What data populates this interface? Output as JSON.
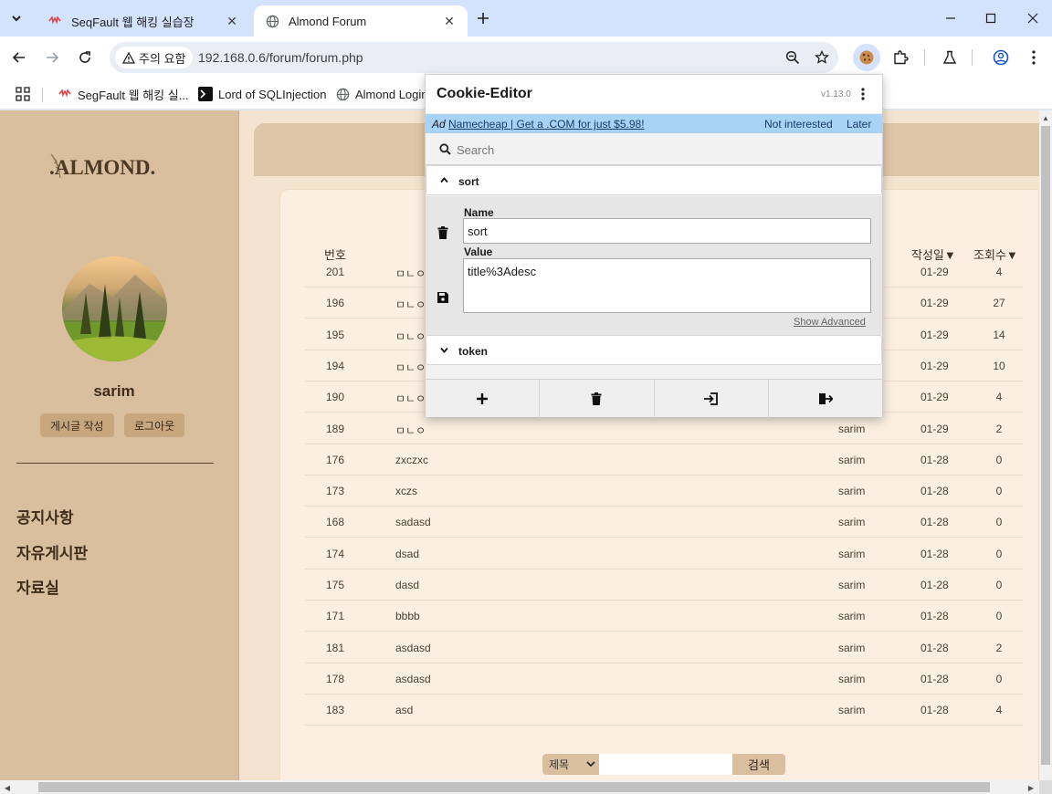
{
  "browser": {
    "tabs": [
      {
        "title": "SeqFault 웹 해킹 실습장",
        "active": false
      },
      {
        "title": "Almond Forum",
        "active": true
      }
    ],
    "security_label": "주의 요함",
    "url": "192.168.0.6/forum/forum.php",
    "bookmarks": [
      {
        "label": "SegFault 웹 해킹 실..."
      },
      {
        "label": "Lord of SQLInjection"
      },
      {
        "label": "Almond Login"
      }
    ]
  },
  "site": {
    "logo": ".ALMOND.",
    "username": "sarim",
    "buttons": {
      "write": "게시글 작성",
      "logout": "로그아웃"
    },
    "menu": [
      "공지사항",
      "자유게시판",
      "자료실"
    ],
    "board": {
      "headers": {
        "no": "번호",
        "date": "작성일▼",
        "views": "조회수▼"
      },
      "rows": [
        {
          "no": "201",
          "title": "ㅁㄴㅇ",
          "author": "",
          "date": "01-29",
          "views": "4"
        },
        {
          "no": "196",
          "title": "ㅁㄴㅇ",
          "author": "",
          "date": "01-29",
          "views": "27"
        },
        {
          "no": "195",
          "title": "ㅁㄴㅇ",
          "author": "",
          "date": "01-29",
          "views": "14"
        },
        {
          "no": "194",
          "title": "ㅁㄴㅇ",
          "author": "",
          "date": "01-29",
          "views": "10"
        },
        {
          "no": "190",
          "title": "ㅁㄴㅇ",
          "author": "",
          "date": "01-29",
          "views": "4"
        },
        {
          "no": "189",
          "title": "ㅁㄴㅇ",
          "author": "sarim",
          "date": "01-29",
          "views": "2"
        },
        {
          "no": "176",
          "title": "zxczxc",
          "author": "sarim",
          "date": "01-28",
          "views": "0"
        },
        {
          "no": "173",
          "title": "xczs",
          "author": "sarim",
          "date": "01-28",
          "views": "0"
        },
        {
          "no": "168",
          "title": "sadasd",
          "author": "sarim",
          "date": "01-28",
          "views": "0"
        },
        {
          "no": "174",
          "title": "dsad",
          "author": "sarim",
          "date": "01-28",
          "views": "0"
        },
        {
          "no": "175",
          "title": "dasd",
          "author": "sarim",
          "date": "01-28",
          "views": "0"
        },
        {
          "no": "171",
          "title": "bbbb",
          "author": "sarim",
          "date": "01-28",
          "views": "0"
        },
        {
          "no": "181",
          "title": "asdasd",
          "author": "sarim",
          "date": "01-28",
          "views": "2"
        },
        {
          "no": "178",
          "title": "asdasd",
          "author": "sarim",
          "date": "01-28",
          "views": "0"
        },
        {
          "no": "183",
          "title": "asd",
          "author": "sarim",
          "date": "01-28",
          "views": "4"
        }
      ]
    },
    "search": {
      "select_value": "제목",
      "button": "검색"
    }
  },
  "cookie_editor": {
    "title": "Cookie-Editor",
    "version": "v1.13.0",
    "ad": {
      "tag": "Ad",
      "link": "Namecheap | Get a .COM for just $5.98!",
      "not_interested": "Not interested",
      "later": "Later"
    },
    "search_placeholder": "Search",
    "cookies": [
      {
        "name": "sort",
        "expanded": true
      },
      {
        "name": "token",
        "expanded": false
      }
    ],
    "name_label": "Name",
    "name_value": "sort",
    "value_label": "Value",
    "value_value": "title%3Adesc",
    "show_advanced": "Show Advanced"
  }
}
